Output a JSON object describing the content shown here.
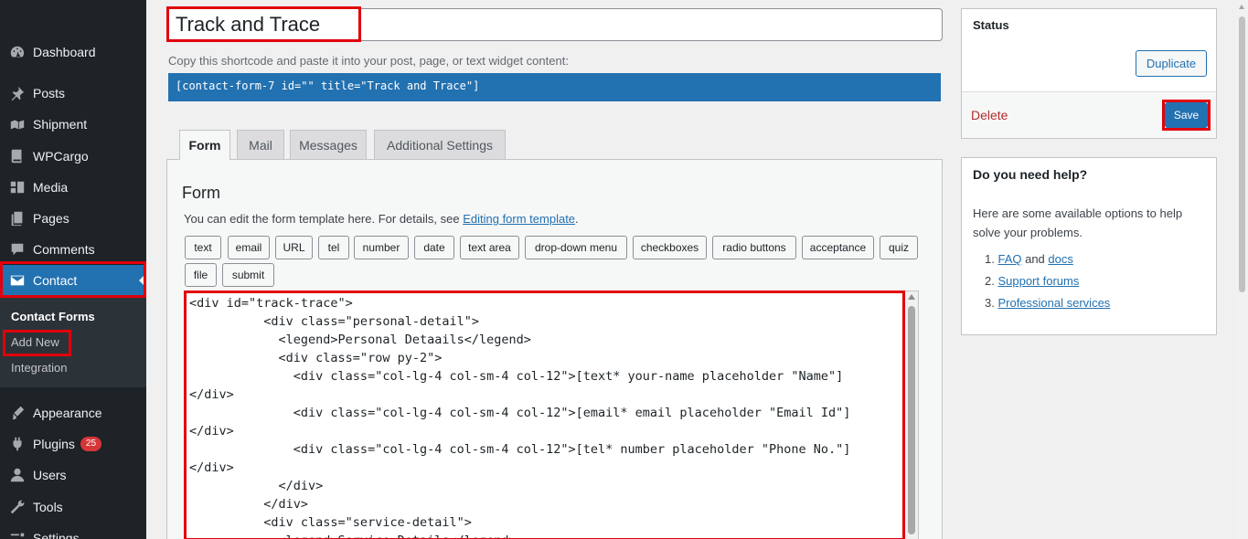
{
  "sidebar": {
    "items": [
      {
        "label": "Dashboard",
        "icon": "dashboard-icon"
      },
      {
        "label": "Posts",
        "icon": "pin-icon"
      },
      {
        "label": "Shipment",
        "icon": "shipment-icon"
      },
      {
        "label": "WPCargo",
        "icon": "book-icon"
      },
      {
        "label": "Media",
        "icon": "media-icon"
      },
      {
        "label": "Pages",
        "icon": "pages-icon"
      },
      {
        "label": "Comments",
        "icon": "comments-icon"
      },
      {
        "label": "Contact",
        "icon": "mail-icon"
      },
      {
        "label": "Appearance",
        "icon": "brush-icon"
      },
      {
        "label": "Plugins",
        "icon": "plugin-icon",
        "badge": "25"
      },
      {
        "label": "Users",
        "icon": "user-icon"
      },
      {
        "label": "Tools",
        "icon": "wrench-icon"
      },
      {
        "label": "Settings",
        "icon": "settings-icon"
      }
    ],
    "submenu": [
      "Contact Forms",
      "Add New",
      "Integration"
    ]
  },
  "form": {
    "title_value": "Track and Trace",
    "shortcode_hint": "Copy this shortcode and paste it into your post, page, or text widget content:",
    "shortcode": "[contact-form-7 id=\"\" title=\"Track and Trace\"]"
  },
  "tabs": [
    "Form",
    "Mail",
    "Messages",
    "Additional Settings"
  ],
  "panel": {
    "heading": "Form",
    "desc_prefix": "You can edit the form template here. For details, see ",
    "desc_link": "Editing form template",
    "desc_suffix": "."
  },
  "tag_buttons": [
    "text",
    "email",
    "URL",
    "tel",
    "number",
    "date",
    "text area",
    "drop-down menu",
    "checkboxes",
    "radio buttons",
    "acceptance",
    "quiz",
    "file",
    "submit"
  ],
  "editor": {
    "content": "<div id=\"track-trace\">\n          <div class=\"personal-detail\">\n            <legend>Personal Detaails</legend>\n            <div class=\"row py-2\">\n              <div class=\"col-lg-4 col-sm-4 col-12\">[text* your-name placeholder \"Name\"]\n</div>\n              <div class=\"col-lg-4 col-sm-4 col-12\">[email* email placeholder \"Email Id\"]\n</div>\n              <div class=\"col-lg-4 col-sm-4 col-12\">[tel* number placeholder \"Phone No.\"]\n</div>\n            </div>\n          </div>\n          <div class=\"service-detail\">\n            <legend>Service Details</legend>"
  },
  "status": {
    "title": "Status",
    "duplicate_label": "Duplicate",
    "delete_label": "Delete",
    "save_label": "Save"
  },
  "help": {
    "title": "Do you need help?",
    "text": "Here are some available options to help solve your problems.",
    "faq": "FAQ",
    "and": " and ",
    "docs": "docs",
    "support": "Support forums",
    "professional": "Professional services"
  },
  "colors": {
    "accent": "#2271b1",
    "highlight_box": "#e1000b",
    "sidebar_bg": "#1d2327",
    "delete": "#b32d2e",
    "badge": "#d63638"
  }
}
